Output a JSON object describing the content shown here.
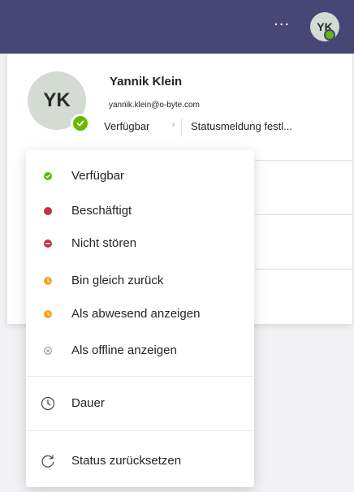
{
  "topbar": {
    "more_label": "···",
    "avatar_initials": "YK",
    "badge_color": "#6bb700"
  },
  "profile": {
    "initials": "YK",
    "name": "Yannik Klein",
    "email": "yannik.klein@o-byte.com",
    "status": "Verfügbar",
    "status_caret": "›",
    "status_message": "Statusmeldung festl..."
  },
  "menu": {
    "items": [
      {
        "label": "Verfügbar",
        "icon": "available-check-icon",
        "color": "#6bb700"
      },
      {
        "label": "Beschäftigt",
        "icon": "busy-dot-icon",
        "color": "#c4314b"
      },
      {
        "label": "Nicht stören",
        "icon": "do-not-disturb-icon",
        "color": "#c4314b"
      },
      {
        "label": "Bin gleich zurück",
        "icon": "be-right-back-clock-icon",
        "color": "#f8a518"
      },
      {
        "label": "Als abwesend anzeigen",
        "icon": "away-clock-icon",
        "color": "#f8a518"
      },
      {
        "label": "Als offline anzeigen",
        "icon": "offline-circle-icon",
        "color": "#8a8886"
      }
    ],
    "duration_label": "Dauer",
    "duration_icon": "clock-icon",
    "reset_label": "Status zurücksetzen",
    "reset_icon": "refresh-icon"
  }
}
